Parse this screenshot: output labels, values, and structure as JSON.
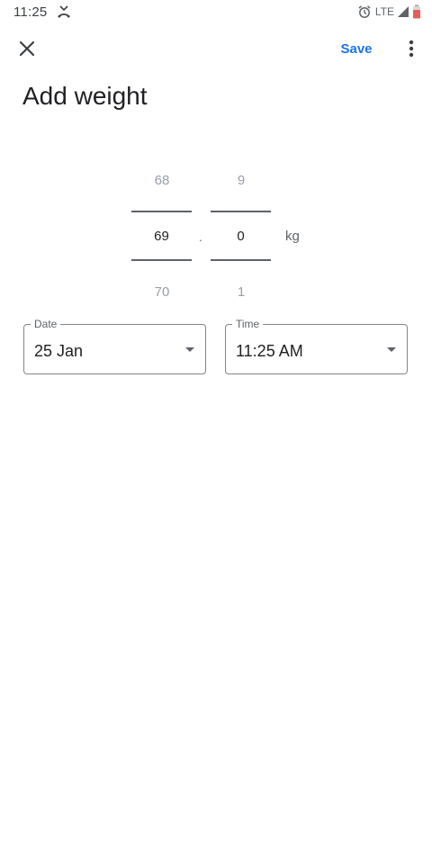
{
  "status_bar": {
    "time": "11:25",
    "network": "LTE",
    "icons": [
      "missed-call-icon",
      "alarm-icon",
      "signal-icon",
      "battery-icon"
    ]
  },
  "app_bar": {
    "close_icon": "close-icon",
    "save_label": "Save",
    "more_icon": "more-vert-icon"
  },
  "title": "Add weight",
  "picker": {
    "integer": {
      "above": "68",
      "selected": "69",
      "below": "70"
    },
    "separator": ".",
    "decimal": {
      "above": "9",
      "selected": "0",
      "below": "1"
    },
    "unit": "kg"
  },
  "date_field": {
    "label": "Date",
    "value": "25 Jan"
  },
  "time_field": {
    "label": "Time",
    "value": "11:25 AM"
  },
  "colors": {
    "accent": "#1a73e8",
    "text_primary": "#202124",
    "text_secondary": "#5f6368",
    "text_dim": "#9aa0a6",
    "battery_low": "#e06055"
  }
}
